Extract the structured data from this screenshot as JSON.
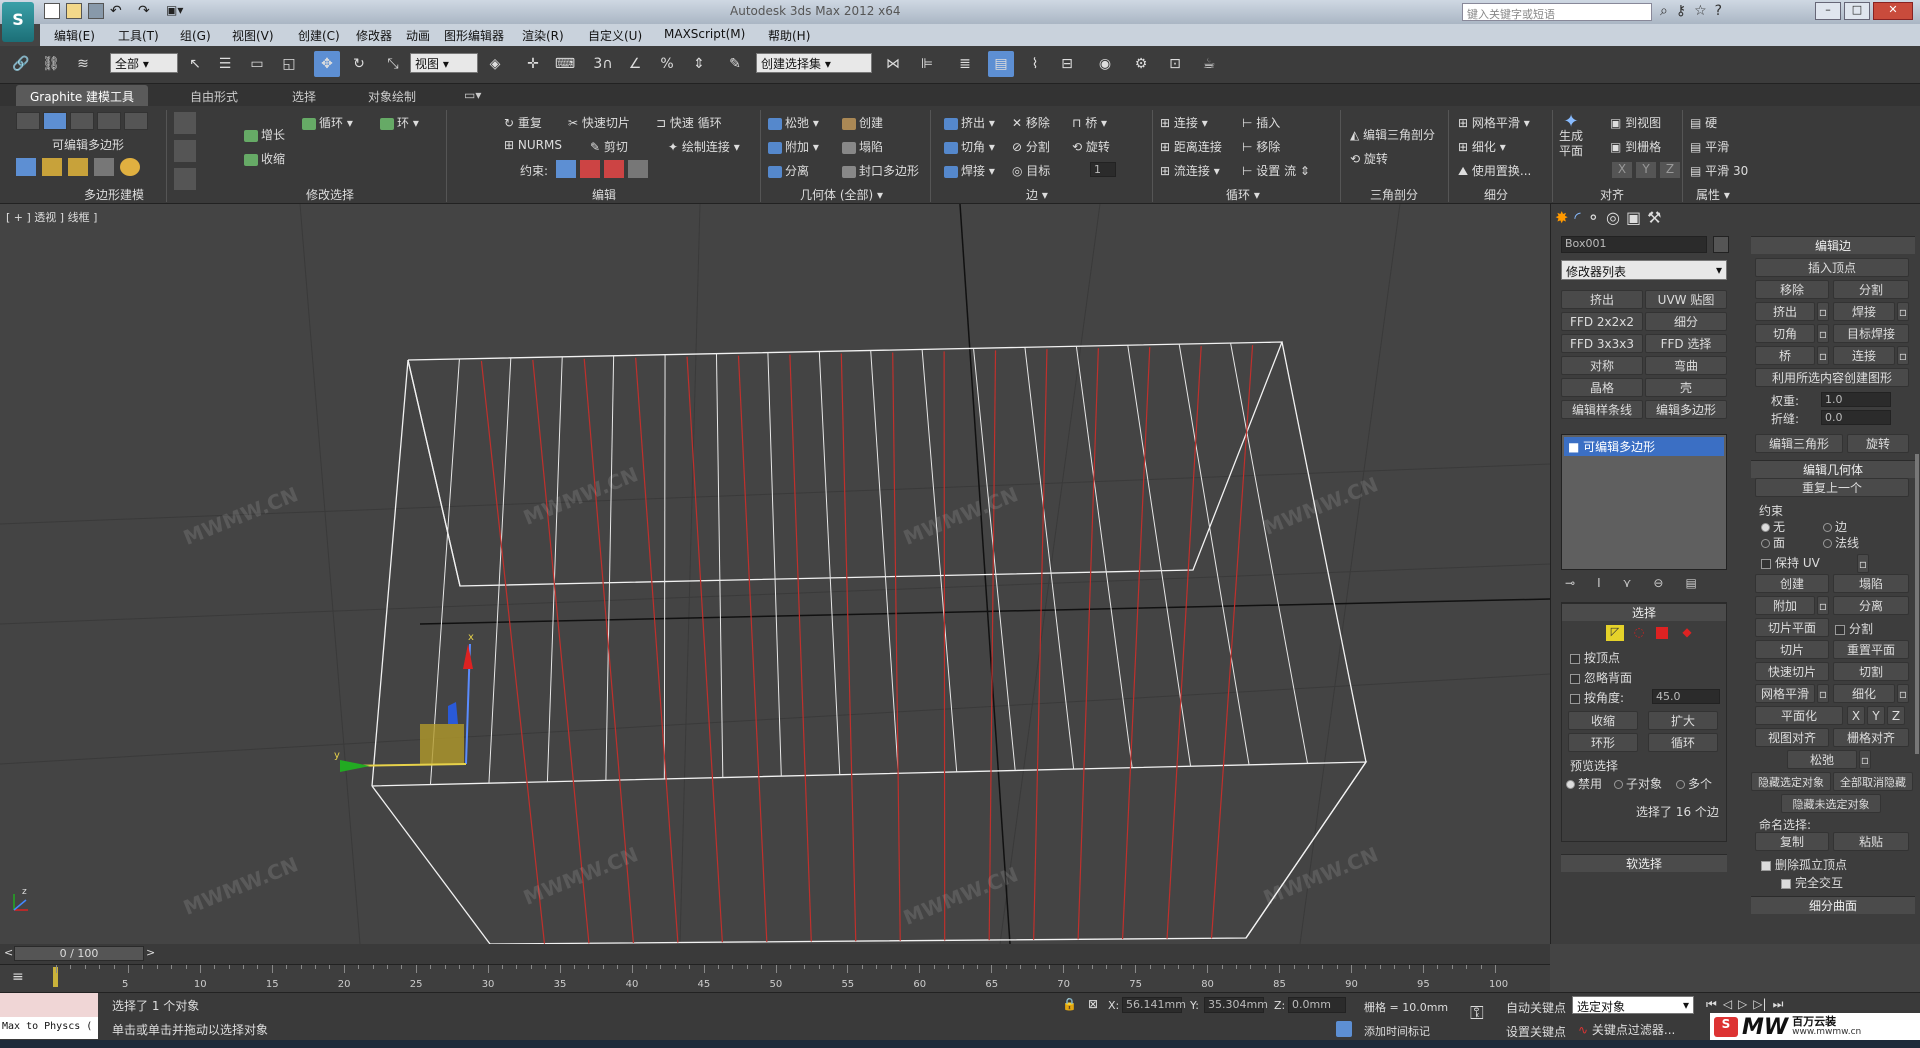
{
  "app": {
    "title": "Autodesk 3ds Max 2012 x64",
    "logo": "3ds-logo-icon"
  },
  "search": {
    "placeholder": "键入关键字或短语"
  },
  "menu": [
    "编辑(E)",
    "工具(T)",
    "组(G)",
    "视图(V)",
    "创建(C)",
    "修改器",
    "动画",
    "图形编辑器",
    "渲染(R)",
    "自定义(U)",
    "MAXScript(M)",
    "帮助(H)"
  ],
  "toolbar": {
    "filter_value": "全部",
    "view_value": "视图",
    "selection_set": "创建选择集",
    "snap_labels": [
      "3",
      "%",
      "%"
    ]
  },
  "ribbon_tabs": [
    "Graphite 建模工具",
    "自由形式",
    "选择",
    "对象绘制"
  ],
  "ribbon": {
    "group_poly": {
      "label": "多边形建模",
      "item": "可编辑多边形"
    },
    "group_modsel": {
      "label": "修改选择",
      "grow": "增长",
      "shrink": "收缩",
      "loop": "循环",
      "ring": "环"
    },
    "group_edit": {
      "label": "编辑",
      "repeat": "重复",
      "quickslice": "快速切片",
      "quickloop": "快速 循环",
      "nurms": "NURMS",
      "cut": "剪切",
      "paintconnect": "绘制连接",
      "constraint": "约束:"
    },
    "group_geom": {
      "label": "几何体 (全部)",
      "relax": "松弛",
      "create": "创建",
      "attach": "附加",
      "collapse": "塌陷",
      "detach": "分离",
      "cap": "封口多边形"
    },
    "group_edge": {
      "label": "边",
      "extrude": "挤出",
      "remove": "移除",
      "bridge": "桥",
      "chamfer": "切角",
      "split": "分割",
      "spin": "旋转",
      "weld": "焊接",
      "target": "目标",
      "spin_value": "1"
    },
    "group_loops": {
      "label": "循环",
      "connect": "连接",
      "insert": "插入",
      "distconnect": "距离连接",
      "remove": "移除",
      "flowconnect": "流连接",
      "setflow": "设置 流"
    },
    "group_tris": {
      "label": "三角剖分",
      "edittri": "编辑三角剖分",
      "turn": "旋转"
    },
    "group_subdiv": {
      "label": "细分",
      "meshsmooth": "网格平滑",
      "tessellate": "细化",
      "usedisp": "使用置换..."
    },
    "group_align": {
      "label": "对齐",
      "genplanar": "生成平面",
      "toview": "到视图",
      "togrid": "到栅格",
      "x": "X",
      "y": "Y",
      "z": "Z"
    },
    "group_props": {
      "label": "属性",
      "hard": "硬",
      "smooth": "平滑",
      "smooth30": "平滑 30"
    }
  },
  "viewport": {
    "label": "[ + ] 透视 ] 线框 ]",
    "axis_x": "x",
    "axis_y": "y",
    "axis_z": "z",
    "watermark": "MWMW.CN"
  },
  "command_panel": {
    "object_name": "Box001",
    "modifier_list": "修改器列表",
    "modifier_buttons": [
      "挤出",
      "UVW 贴图",
      "FFD 2x2x2",
      "细分",
      "FFD 3x3x3",
      "FFD 选择",
      "对称",
      "弯曲",
      "晶格",
      "壳",
      "编辑样条线",
      "编辑多边形"
    ],
    "stack_item": "可编辑多边形",
    "selection": {
      "title": "选择",
      "by_vertex": "按顶点",
      "ignore_back": "忽略背面",
      "by_angle": "按角度:",
      "angle_value": "45.0",
      "shrink": "收缩",
      "grow": "扩大",
      "ring": "环形",
      "loop": "循环",
      "preview": "预览选择",
      "off": "禁用",
      "subobj": "子对象",
      "multi": "多个",
      "status": "选择了 16 个边"
    },
    "softsel": "软选择"
  },
  "edit_edges": {
    "title": "编辑边",
    "insert_vertex": "插入顶点",
    "remove": "移除",
    "split": "分割",
    "extrude": "挤出",
    "weld": "焊接",
    "chamfer": "切角",
    "target_weld": "目标焊接",
    "bridge": "桥",
    "connect": "连接",
    "create_shape": "利用所选内容创建图形",
    "weight_label": "权重:",
    "weight": "1.0",
    "crease_label": "折缝:",
    "crease": "0.0",
    "edit_tri": "编辑三角形",
    "turn": "旋转"
  },
  "edit_geom": {
    "title": "编辑几何体",
    "repeat_last": "重复上一个",
    "constraints": "约束",
    "none": "无",
    "edge": "边",
    "face": "面",
    "normal": "法线",
    "preserve_uv": "保持 UV",
    "create": "创建",
    "collapse": "塌陷",
    "attach": "附加",
    "detach": "分离",
    "slice_plane": "切片平面",
    "split": "分割",
    "slice": "切片",
    "reset_plane": "重置平面",
    "quickslice": "快速切片",
    "cut": "切割",
    "meshsmooth": "网格平滑",
    "tessellate": "细化",
    "make_planar": "平面化",
    "x": "X",
    "y": "Y",
    "z": "Z",
    "view_align": "视图对齐",
    "grid_align": "栅格对齐",
    "relax": "松弛",
    "hide_sel": "隐藏选定对象",
    "unhide_all": "全部取消隐藏",
    "hide_unsel": "隐藏未选定对象",
    "named_sel": "命名选择:",
    "copy": "复制",
    "paste": "粘贴",
    "delete_iso": "删除孤立顶点",
    "full_interact": "完全交互",
    "subdiv_surface": "细分曲面"
  },
  "timeline": {
    "frame": "0 / 100",
    "ticks": [
      "5",
      "10",
      "15",
      "20",
      "25",
      "30",
      "35",
      "40",
      "45",
      "50",
      "55",
      "60",
      "65",
      "70",
      "75",
      "80",
      "85",
      "90",
      "95",
      "100"
    ]
  },
  "status": {
    "max_script": "Max to Physcs (",
    "selected": "选择了 1 个对象",
    "prompt": "单击或单击并拖动以选择对象",
    "x_label": "X:",
    "x": "56.141mm",
    "y_label": "Y:",
    "y": "35.304mm",
    "z_label": "Z:",
    "z": "0.0mm",
    "grid": "栅格 = 10.0mm",
    "autokey": "自动关键点",
    "setkey": "设置关键点",
    "selected_obj": "选定对象",
    "keyfilter": "关键点过滤器...",
    "addtime": "添加时间标记",
    "brand": "百万云装",
    "brand_url": "www.mwmw.cn"
  }
}
